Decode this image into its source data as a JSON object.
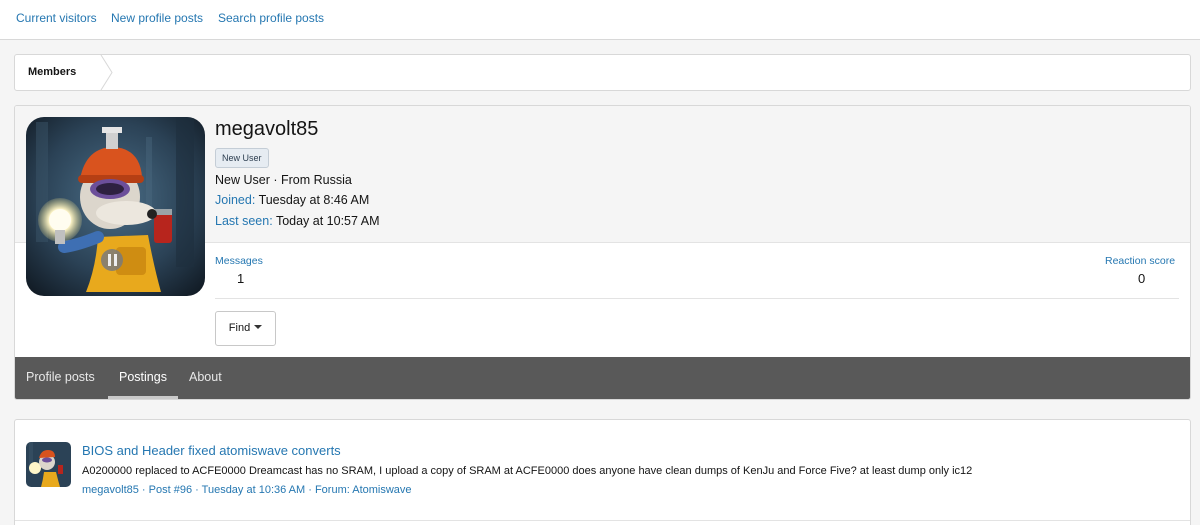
{
  "subnav": {
    "items": [
      "Current visitors",
      "New profile posts",
      "Search profile posts"
    ]
  },
  "breadcrumb": {
    "label": "Members"
  },
  "profile": {
    "username": "megavolt85",
    "badge": "New User",
    "title_line": "New User · From Russia",
    "joined_label": "Joined:",
    "joined_value": "Tuesday at 8:46 AM",
    "last_seen_label": "Last seen:",
    "last_seen_value": "Today at 10:57 AM",
    "stats": {
      "messages_label": "Messages",
      "messages_value": "1",
      "reaction_label": "Reaction score",
      "reaction_value": "0"
    },
    "find_label": "Find"
  },
  "tabs": [
    "Profile posts",
    "Postings",
    "About"
  ],
  "active_tab": "Postings",
  "posts": [
    {
      "title": "BIOS and Header fixed atomiswave converts",
      "snippet": "A0200000 replaced to ACFE0000 Dreamcast has no SRAM, I upload a copy of SRAM at ACFE0000 does anyone have clean dumps of KenJu and Force Five? at least dump only ic12",
      "meta": "megavolt85 · Post #96 · Tuesday at 10:36 AM · Forum: Atomiswave"
    }
  ],
  "colors": {
    "link": "#2577b1",
    "tab_bar": "#595959",
    "page_bg": "#f5f5f5"
  },
  "icons": {
    "find_dropdown": "caret-down-icon",
    "breadcrumb_separator": "chevron-right-icon"
  }
}
